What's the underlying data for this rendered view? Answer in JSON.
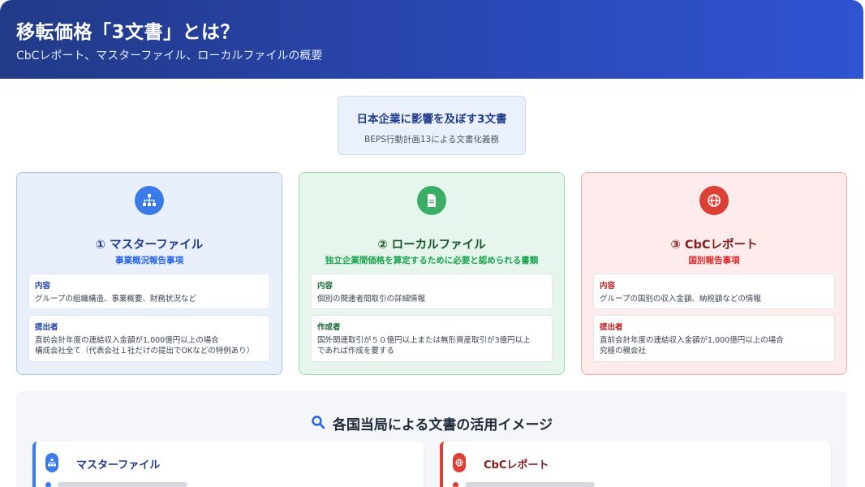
{
  "header": {
    "title": "移転価格「3文書」とは？",
    "subtitle": "CbCレポート、マスターファイル、ローカルファイルの概要"
  },
  "summary": {
    "title": "日本企業に影響を及ぼす3文書",
    "subtitle": "BEPS行動計画13による文書化義務"
  },
  "colors": {
    "header_start": "#223a87",
    "header_end": "#2f54d2",
    "blue": "#3b7be8",
    "green": "#3aae64",
    "red": "#dc3f35"
  },
  "cards": [
    {
      "icon": "org-chart-icon",
      "title": "① マスターファイル",
      "subtitle": "事業概況報告事項",
      "content_label": "内容",
      "content_text": "グループの組織構造、事業概要、財務状況など",
      "submitter_label": "提出者",
      "submitter_line1": "直前会計年度の連結収入金額が1,000億円以上の場合",
      "submitter_line2": "構成会社全て（代表会社１社だけの提出でOKなどの特例あり）"
    },
    {
      "icon": "document-icon",
      "title": "② ローカルファイル",
      "subtitle": "独立企業間価格を算定するために必要と認められる書類",
      "content_label": "内容",
      "content_text": "個別の関連者間取引の詳細情報",
      "submitter_label": "作成者",
      "submitter_line1": "国外関連取引が５０億円以上または無形資産取引が3億円以上",
      "submitter_line2": "であれば作成を要する"
    },
    {
      "icon": "globe-icon",
      "title": "③ CbCレポート",
      "subtitle": "国別報告事項",
      "content_label": "内容",
      "content_text": "グループの国別の収入金額、納税額などの情報",
      "submitter_label": "提出者",
      "submitter_line1": "直前会計年度の連結収入金額が1,000億円以上の場合",
      "submitter_line2": "究極の親会社"
    }
  ],
  "usage": {
    "title": "各国当局による文書の活用イメージ",
    "icon": "search-icon",
    "left_title": "マスターファイル",
    "right_title": "CbCレポート"
  }
}
